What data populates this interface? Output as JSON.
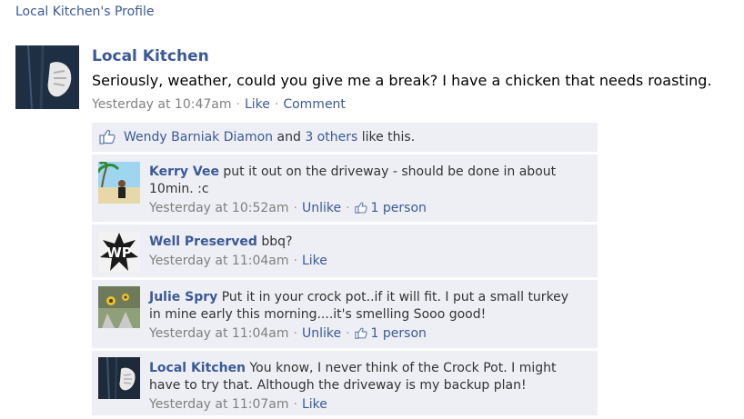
{
  "profile_link": "Local Kitchen's Profile",
  "post": {
    "author": "Local Kitchen",
    "message": "Seriously, weather, could you give me a break? I have a chicken that needs roasting.",
    "timestamp": "Yesterday at 10:47am",
    "like_label": "Like",
    "comment_label": "Comment",
    "separator": "·"
  },
  "likes": {
    "first_liker": "Wendy Barniak Diamon",
    "and_text": "and",
    "others_link": "3 others",
    "like_this_text": "like this."
  },
  "comments": [
    {
      "author": "Kerry Vee",
      "text": "put it out on the driveway - should be done in about 10min. :c",
      "timestamp": "Yesterday at 10:52am",
      "action": "Unlike",
      "likes": "1 person"
    },
    {
      "author": "Well Preserved",
      "text": "bbq?",
      "timestamp": "Yesterday at 11:04am",
      "action": "Like",
      "likes": ""
    },
    {
      "author": "Julie Spry",
      "text": "Put it in your crock pot..if it will fit. I put a small turkey in mine early this morning....it's smelling Sooo good!",
      "timestamp": "Yesterday at 11:04am",
      "action": "Unlike",
      "likes": "1 person"
    },
    {
      "author": "Local Kitchen",
      "text": "You know, I never think of the Crock Pot. I might have to try that. Although the driveway is my backup plan!",
      "timestamp": "Yesterday at 11:07am",
      "action": "Like",
      "likes": ""
    }
  ],
  "avatar_logo_text": "WP",
  "colors": {
    "link": "#3b5998",
    "comment_bg": "#edeff4",
    "meta_gray": "#808080"
  }
}
